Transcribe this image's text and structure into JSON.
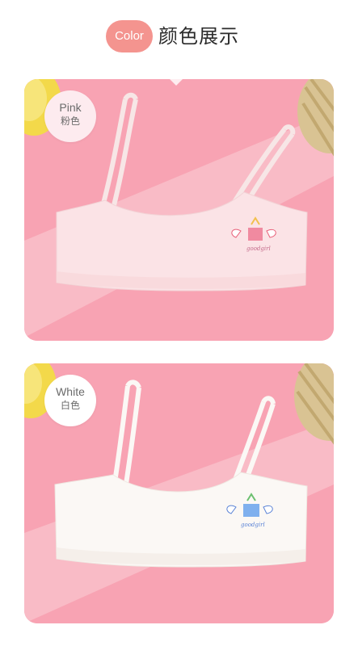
{
  "header": {
    "badge": "Color",
    "title": "颜色展示"
  },
  "variants": [
    {
      "en": "Pink",
      "zh": "粉色",
      "embroidery": "goodgirl"
    },
    {
      "en": "White",
      "zh": "白色",
      "embroidery": "goodgirl"
    }
  ],
  "colors": {
    "badge": "#f4948f",
    "background": "#f8a3b3",
    "pink_garment": "#fbe3e6",
    "white_garment": "#fbf8f5"
  }
}
